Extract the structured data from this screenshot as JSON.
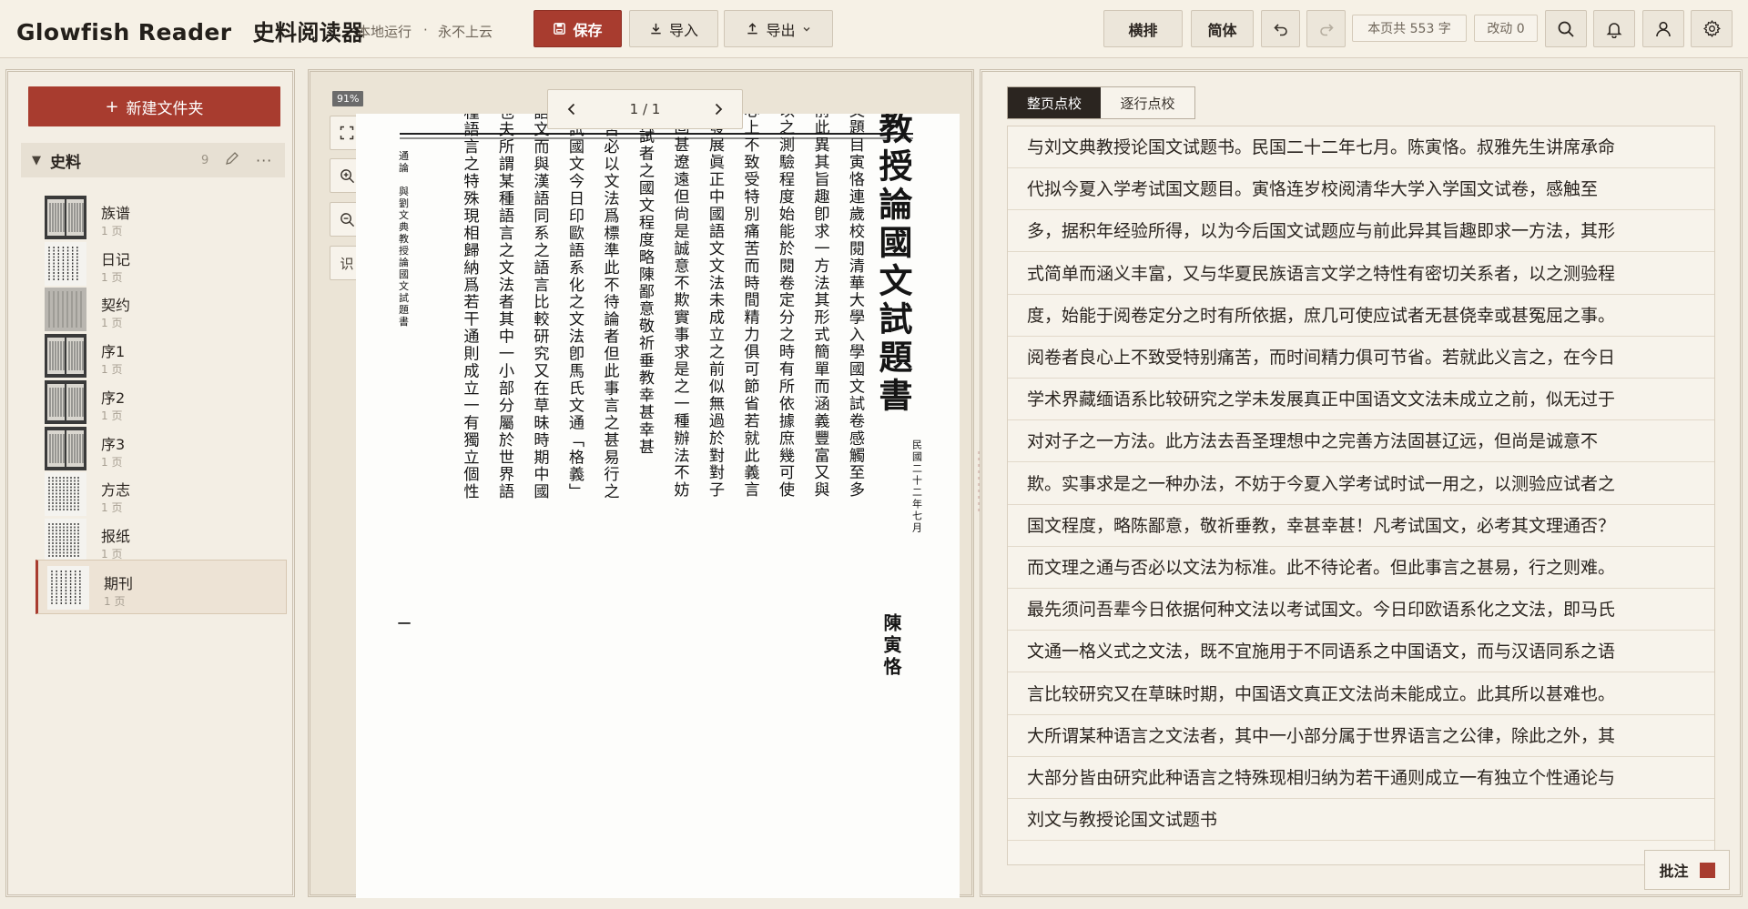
{
  "header": {
    "brand": "Glowfish Reader",
    "subtitle_cn": "史料阅读器",
    "run_mode": "本地运行",
    "separator": "·",
    "no_cloud": "永不上云",
    "save_label": "保存",
    "import_label": "导入",
    "export_label": "导出",
    "layout_label": "横排",
    "script_label": "简体",
    "page_char_count": "本页共 553 字",
    "changes": "改动 0"
  },
  "colors": {
    "accent": "#a83c2f",
    "background": "#f1ece1",
    "dark": "#2b2520"
  },
  "sidebar": {
    "new_folder_label": "新建文件夹",
    "folder": {
      "name": "史料",
      "count": "9"
    },
    "items": [
      {
        "name": "族谱",
        "pages": "1 页"
      },
      {
        "name": "日记",
        "pages": "1 页"
      },
      {
        "name": "契约",
        "pages": "1 页"
      },
      {
        "name": "序1",
        "pages": "1 页"
      },
      {
        "name": "序2",
        "pages": "1 页"
      },
      {
        "name": "序3",
        "pages": "1 页"
      },
      {
        "name": "方志",
        "pages": "1 页"
      },
      {
        "name": "报纸",
        "pages": "1 页"
      },
      {
        "name": "期刊",
        "pages": "1 页"
      }
    ],
    "active_item": "期刊"
  },
  "viewer": {
    "zoom": "91%",
    "page_indicator": "1 / 1",
    "ocr_button": "识",
    "scan_title": "與劉文典教授論國文試題書",
    "scan_date": "民國二十二年七月",
    "scan_author": "陳寅恪",
    "scan_columns": [
      "叔雅先生講席承命代擬今夏入學考試國文題目寅恪連歲校閱清華大學入學國文試卷感觸至多",
      "據積年經驗所得以爲今後國文試題應與前此異其旨趣卽求一方法其形式簡單而涵義豐富又與",
      "華夏民族語言文學之特性有密切關係者以之測驗程度始能於閱卷定分之時有所依據庶幾可使",
      "應試者無甚僥倖或甚冤屈之事閱卷者良心上不致受特別痛苦而時間精力俱可節省若就此義言",
      "之在今日學術界藏緬語系比較研究之學未發展眞正中國語文文法未成立之前似無過於對對子",
      "之一方法此方法去吾聖理想中之完善方法固甚遼遠但尙是誠意不欺實事求是之一種辦法不妨",
      "於今夏入學考試時試一用之以測驗應試者之國文程度略陳鄙意敬祈垂教幸甚幸甚",
      "凡考試國文必考其文理通否而文理之通與否必以文法爲標準此不待論者但此事言之甚易行之",
      "則難最先須問吾輩今日依據何種文法以考試國文今日印歐語系化之文法卽馬氏文通「格義」",
      "式之文法旣不宜施用於不同語系之中國語文而與漢語同系之語言比較研究又在草昧時期中國",
      "語文眞正文法尙未能成立此其所以甚難也夫所謂某種語言之文法者其中一小部分屬於世界語",
      "言之公律除此之外其大部分皆由研究此種語言之特殊現相歸納爲若干通則成立一有獨立個性"
    ],
    "scan_footer": "通論　與劉文典教授論國文試題書",
    "scan_page_mark": "一"
  },
  "editor": {
    "tab_page": "整页点校",
    "tab_line": "逐行点校",
    "lines": [
      "与刘文典教授论国文试题书。民国二十二年七月。陈寅恪。叔雅先生讲席承命",
      "代拟今夏入学考试国文题目。寅恪连岁校阅清华大学入学国文试卷，感触至",
      "多，据积年经验所得，以为今后国文试题应与前此异其旨趣即求一方法，其形",
      "式简单而涵义丰富，又与华夏民族语言文学之特性有密切关系者，以之测验程",
      "度，始能于阅卷定分之时有所依据，庶几可使应试者无甚侥幸或甚冤屈之事。",
      "阅卷者良心上不致受特别痛苦，而时间精力俱可节省。若就此义言之，在今日",
      "学术界藏缅语系比较研究之学未发展真正中国语文文法未成立之前，似无过于",
      "对对子之一方法。此方法去吾圣理想中之完善方法固甚辽远，但尚是诚意不",
      "欺。实事求是之一种办法，不妨于今夏入学考试时试一用之，以测验应试者之",
      "国文程度，略陈鄙意，敬祈垂教，幸甚幸甚！凡考试国文，必考其文理通否？",
      "而文理之通与否必以文法为标准。此不待论者。但此事言之甚易，行之则难。",
      "最先须问吾辈今日依据何种文法以考试国文。今日印欧语系化之文法，即马氏",
      "文通一格义式之文法，既不宜施用于不同语系之中国语文，而与汉语同系之语",
      "言比较研究又在草昧时期，中国语文真正文法尚未能成立。此其所以甚难也。",
      "大所谓某种语言之文法者，其中一小部分属于世界语言之公律，除此之外，其",
      "大部分皆由研究此种语言之特殊现相归纳为若干通则成立一有独立个性通论与",
      "刘文与教授论国文试题书"
    ],
    "annotate_label": "批注"
  }
}
